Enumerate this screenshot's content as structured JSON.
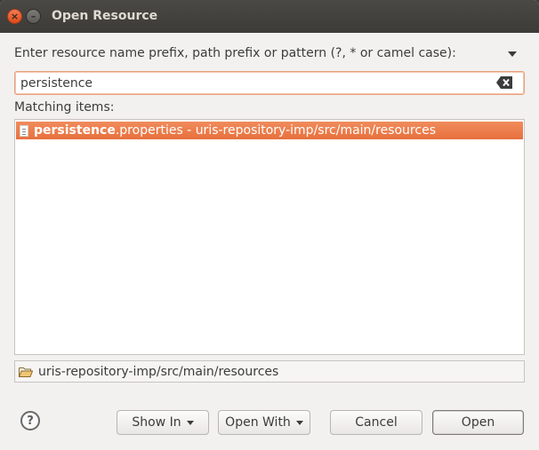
{
  "window": {
    "title": "Open Resource",
    "close_glyph": "×",
    "minimize_glyph": "–"
  },
  "prompt": "Enter resource name prefix, path prefix or pattern (?, * or camel case):",
  "search": {
    "value": "persistence",
    "placeholder": ""
  },
  "matching_label": "Matching items:",
  "items": [
    {
      "match": "persistence",
      "rest": ".properties - uris-repository-imp/src/main/resources",
      "selected": true
    }
  ],
  "selected_path": "uris-repository-imp/src/main/resources",
  "buttons": {
    "help": "?",
    "show_in": "Show In",
    "open_with": "Open With",
    "cancel": "Cancel",
    "open": "Open"
  },
  "colors": {
    "selection": "#e8703d",
    "titlebar": "#3c3b37",
    "close_button": "#df4a16"
  }
}
